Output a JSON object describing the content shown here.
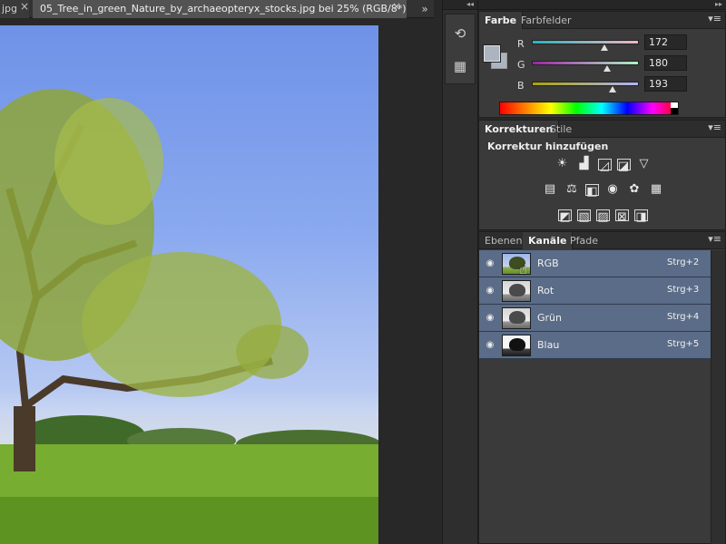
{
  "document": {
    "prev_tab_label": "jpg",
    "active_tab_label": "05_Tree_in_green_Nature_by_archaeopteryx_stocks.jpg bei 25% (RGB/8*)",
    "close_glyph": "×",
    "more_glyph": "»"
  },
  "dock": {
    "collapse_glyph": "◂◂",
    "buttons": [
      {
        "icon": "history-icon",
        "glyph": "⟲"
      },
      {
        "icon": "properties-icon",
        "glyph": "▦"
      }
    ]
  },
  "panels_collapse_glyph": "▸▸",
  "color_panel": {
    "tabs": [
      "Farbe",
      "Farbfelder"
    ],
    "active_tab": "Farbe",
    "menu_glyph": "▾≡",
    "foreground_color": "#acb4c1",
    "channels": [
      {
        "label": "R",
        "value": "172",
        "fraction": 0.675,
        "gradient": "linear-gradient(90deg,#2ab3c0,#f2b4c1)"
      },
      {
        "label": "G",
        "value": "180",
        "fraction": 0.706,
        "gradient": "linear-gradient(90deg,#a020a8,#acf4c1)"
      },
      {
        "label": "B",
        "value": "193",
        "fraction": 0.757,
        "gradient": "linear-gradient(90deg,#aca400,#acb4ff)"
      }
    ]
  },
  "adjustments_panel": {
    "tabs": [
      "Korrekturen",
      "Stile"
    ],
    "active_tab": "Korrekturen",
    "title": "Korrektur hinzufügen",
    "rows": [
      [
        {
          "name": "brightness-contrast-icon",
          "glyph": "☀"
        },
        {
          "name": "levels-icon",
          "glyph": "▟"
        },
        {
          "name": "curves-icon",
          "glyph": "◿"
        },
        {
          "name": "exposure-icon",
          "glyph": "◪"
        },
        {
          "name": "vibrance-icon",
          "glyph": "▽"
        }
      ],
      [
        {
          "name": "hue-saturation-icon",
          "glyph": "▤"
        },
        {
          "name": "color-balance-icon",
          "glyph": "⚖"
        },
        {
          "name": "black-white-icon",
          "glyph": "◧"
        },
        {
          "name": "photo-filter-icon",
          "glyph": "◉"
        },
        {
          "name": "channel-mixer-icon",
          "glyph": "✿"
        },
        {
          "name": "color-lookup-icon",
          "glyph": "▦"
        }
      ],
      [
        {
          "name": "invert-icon",
          "glyph": "◩"
        },
        {
          "name": "posterize-icon",
          "glyph": "▧"
        },
        {
          "name": "threshold-icon",
          "glyph": "▨"
        },
        {
          "name": "selective-color-icon",
          "glyph": "⊠"
        },
        {
          "name": "gradient-map-icon",
          "glyph": "◨"
        }
      ]
    ]
  },
  "channels_panel": {
    "tabs": [
      "Ebenen",
      "Kanäle",
      "Pfade"
    ],
    "active_tab": "Kanäle",
    "channels": [
      {
        "name": "RGB",
        "shortcut": "Strg+2",
        "thumb": "color"
      },
      {
        "name": "Rot",
        "shortcut": "Strg+3",
        "thumb": "gray"
      },
      {
        "name": "Grün",
        "shortcut": "Strg+4",
        "thumb": "gray"
      },
      {
        "name": "Blau",
        "shortcut": "Strg+5",
        "thumb": "dark"
      }
    ],
    "eye_glyph": "◉",
    "hand_glyph": "☝"
  }
}
